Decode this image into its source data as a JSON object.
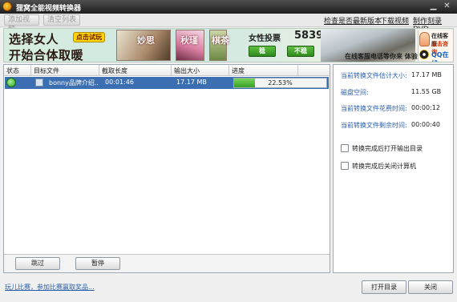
{
  "window": {
    "title": "狸窝全能视频转换器"
  },
  "toolbar": {
    "add_file": "添加视频",
    "clear_list": "清空列表",
    "links": [
      "检查是否最新版本",
      "下载视频",
      "制作刻录DVD"
    ]
  },
  "banner": {
    "line1": "选择女人",
    "line2": "开始合体取暖",
    "click_label": "点击试玩",
    "pic_labels": [
      "妙思",
      "秋瑾",
      "棋茶"
    ],
    "game_label": "女性投票",
    "score": "5839",
    "steady": "稳",
    "unstable": "不稳",
    "slogan": "在线客服电话等你来 体验",
    "service_line1": "在线客服",
    "service_line2": "点击咨询",
    "service_qq": "QQ在线"
  },
  "table": {
    "headers": [
      "状态",
      "目标文件",
      "截取长度",
      "输出大小",
      "进度"
    ],
    "rows": [
      {
        "file": "bonny品牌介绍...",
        "duration": "00:01:46",
        "size": "17.17 MB",
        "progress_text": "22.53%",
        "progress": 0.2253
      }
    ]
  },
  "list_buttons": {
    "skip": "跳过",
    "pause": "暂停"
  },
  "info": {
    "items": [
      {
        "label": "当前转换文件估计大小:",
        "value": "17.17 MB"
      },
      {
        "label": "磁盘空间:",
        "value": "11.55 GB"
      },
      {
        "label": "当前转换文件花费时间:",
        "value": "00:00:12"
      },
      {
        "label": "当前转换文件剩余时间:",
        "value": "00:00:40"
      }
    ],
    "checkboxes": [
      "转换完成后打开输出目录",
      "转换完成后关闭计算机"
    ]
  },
  "footer": {
    "promo": "玩儿比赛，参加比赛赢取奖品...",
    "open_dir": "打开目录",
    "close": "关闭"
  }
}
